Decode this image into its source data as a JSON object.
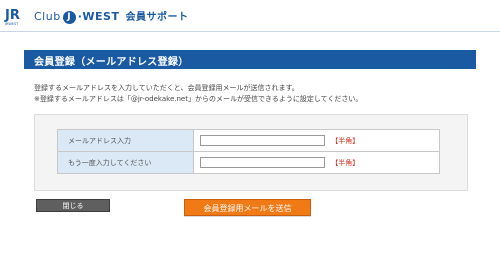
{
  "header": {
    "logo_text": "JR",
    "logo_sub": "JRWEST",
    "brand_club": "Club",
    "brand_j": "J",
    "brand_west": "·WEST",
    "brand_sub": "会員サポート"
  },
  "title": "会員登録（メールアドレス登録）",
  "intro": {
    "line1": "登録するメールアドレスを入力していただくと、会員登録用メールが送信されます。",
    "line2": "※登録するメールアドレスは「@jr-odekake.net」からのメールが受信できるように設定してください。"
  },
  "form": {
    "rows": [
      {
        "label": "メールアドレス入力",
        "value": "",
        "note": "【半角】"
      },
      {
        "label": "もう一度入力してください",
        "value": "",
        "note": "【半角】"
      }
    ]
  },
  "buttons": {
    "close_label": "閉じる",
    "send_label": "会員登録用メールを送信"
  },
  "colors": {
    "accent": "#1a5aa3",
    "send_button": "#f07a16",
    "label_bg": "#dbe9f6",
    "note": "#d0301c"
  }
}
